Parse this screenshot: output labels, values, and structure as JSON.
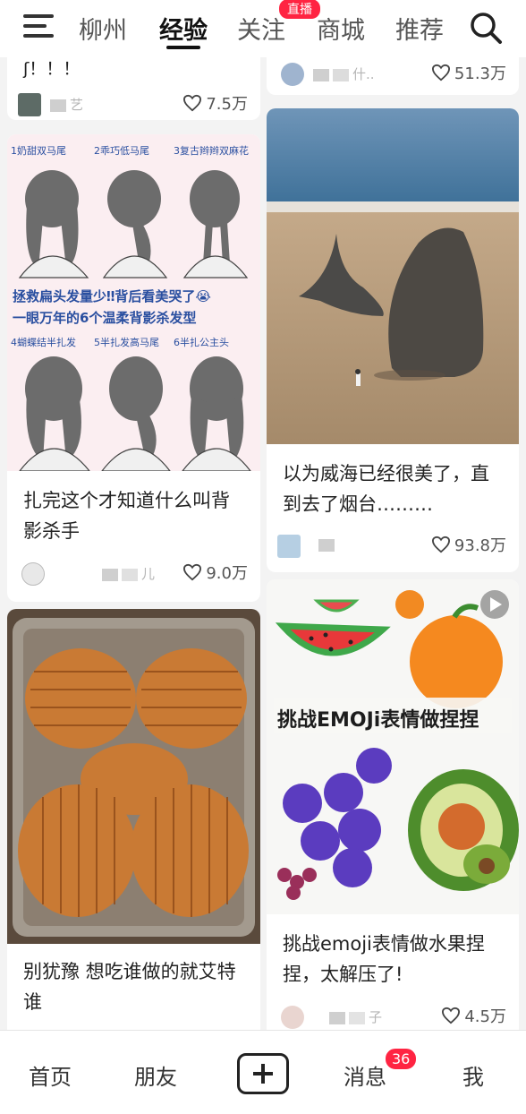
{
  "top_nav": {
    "tabs": [
      "柳州",
      "经验",
      "关注",
      "商城",
      "推荐"
    ],
    "active_tab": "经验",
    "live_badge": "直播"
  },
  "feed": {
    "top_left_fragment": {
      "title_tail": "ʃ！！！",
      "author_suffix": "艺",
      "likes": "7.5万"
    },
    "top_right_fragment": {
      "author_suffix": "什..",
      "likes": "51.3万"
    },
    "cards": [
      {
        "cover": {
          "row1_labels": [
            "1奶甜双马尾",
            "2乖巧低马尾",
            "3复古辫辫双麻花"
          ],
          "headline_line1": "拯救扁头发量少‼背后看美哭了😭",
          "headline_line2": "一眼万年的6个温柔背影杀发型",
          "row2_labels": [
            "4蝴蝶结半扎发",
            "5半扎发高马尾",
            "6半扎公主头"
          ]
        },
        "title": "扎完这个才知道什么叫背影杀手",
        "author_suffix": "儿",
        "likes": "9.0万"
      },
      {
        "title": "以为威海已经很美了，直到去了烟台………",
        "author_suffix": "",
        "likes": "93.8万"
      },
      {
        "title": "别犹豫 想吃谁做的就艾特谁",
        "author_suffix": "",
        "likes": ""
      },
      {
        "cover": {
          "overlay_text": "挑战EMOJi表情做捏捏"
        },
        "title": "挑战emoji表情做水果捏捏，太解压了!",
        "author_suffix": "子",
        "likes": "4.5万"
      }
    ]
  },
  "bottom_nav": {
    "items": [
      "首页",
      "朋友",
      "消息",
      "我"
    ],
    "message_badge": "36"
  },
  "colors": {
    "accent": "#ff2442",
    "text": "#222222",
    "background": "#f3f3f3"
  },
  "icons": [
    "menu-icon",
    "search-icon",
    "heart-icon",
    "plus-icon",
    "play-icon"
  ]
}
